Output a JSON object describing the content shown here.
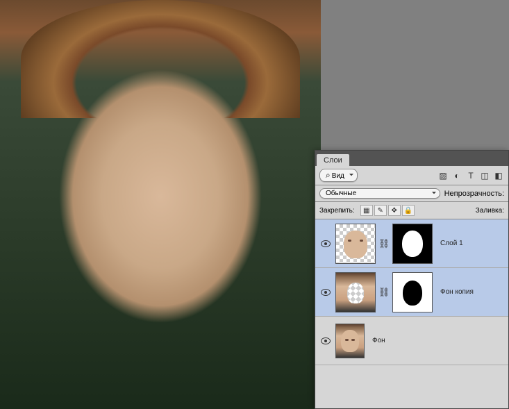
{
  "panel": {
    "tab_label": "Слои",
    "filter_label": "Вид",
    "blend_mode": "Обычные",
    "opacity_label": "Непрозрачность:",
    "lock_label": "Закрепить:",
    "fill_label": "Заливка:"
  },
  "layers": [
    {
      "name": "Слой 1",
      "visible": true,
      "selected": true,
      "has_mask": true,
      "mask_type": "black_with_white_blob",
      "thumb_type": "face_on_checker"
    },
    {
      "name": "Фон копия",
      "visible": true,
      "selected": true,
      "has_mask": true,
      "mask_type": "white_with_black_blob",
      "thumb_type": "photo_with_cutout"
    },
    {
      "name": "Фон",
      "visible": true,
      "selected": false,
      "has_mask": false,
      "thumb_type": "photo"
    }
  ],
  "filter_icons": [
    "image-filter-icon",
    "adjust-filter-icon",
    "type-filter-icon",
    "shape-filter-icon",
    "smart-filter-icon"
  ]
}
